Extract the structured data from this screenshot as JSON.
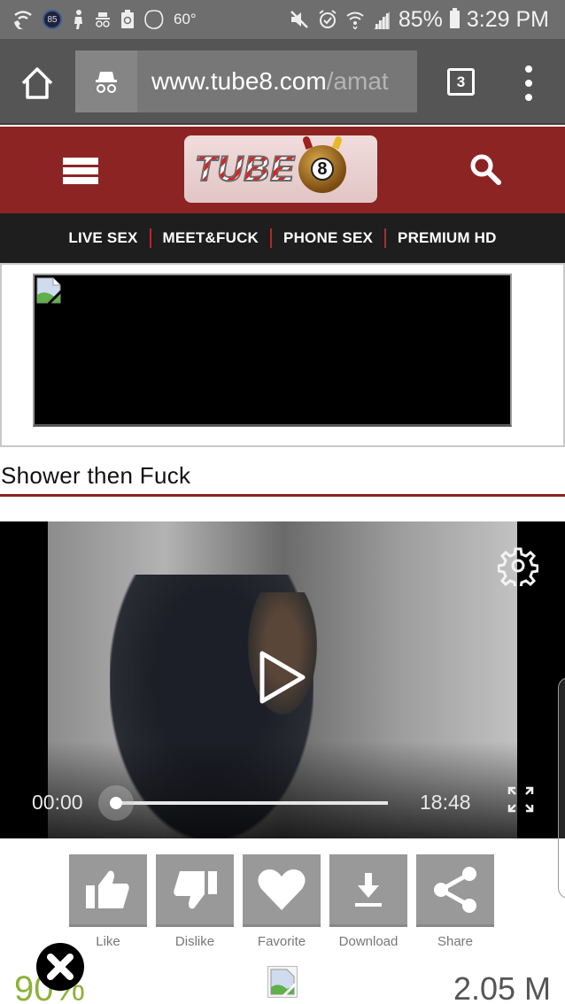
{
  "status_bar": {
    "notification_icons": [
      "wifi-call-icon",
      "badge-85-icon",
      "figure-icon",
      "incognito-icon",
      "battery-saver-icon",
      "blob-icon"
    ],
    "badge_value": "85",
    "temperature": "60°",
    "system_icons": [
      "mute-icon",
      "alarm-icon",
      "wifi-icon",
      "signal-icon"
    ],
    "battery_percent": "85%",
    "time": "3:29 PM"
  },
  "browser": {
    "url_host": "www.tube8.com",
    "url_path": "/amat",
    "tab_count": "3"
  },
  "site": {
    "logo_text": "TUBE",
    "logo_ball_number": "8",
    "nav_links": [
      "LIVE SEX",
      "MEET&FUCK",
      "PHONE SEX",
      "PREMIUM HD"
    ],
    "colors": {
      "header": "#8d2424",
      "nav": "#1e1e1e",
      "rating": "#8db13a"
    }
  },
  "video": {
    "title": "Shower then Fuck",
    "current_time": "00:00",
    "duration": "18:48",
    "progress_fraction": 0.0
  },
  "actions": [
    {
      "label": "Like",
      "icon": "thumbs-up-icon"
    },
    {
      "label": "Dislike",
      "icon": "thumbs-down-icon"
    },
    {
      "label": "Favorite",
      "icon": "heart-icon"
    },
    {
      "label": "Download",
      "icon": "download-icon"
    },
    {
      "label": "Share",
      "icon": "share-icon"
    }
  ],
  "stats": {
    "rating": "90%",
    "views": "2.05 M"
  }
}
